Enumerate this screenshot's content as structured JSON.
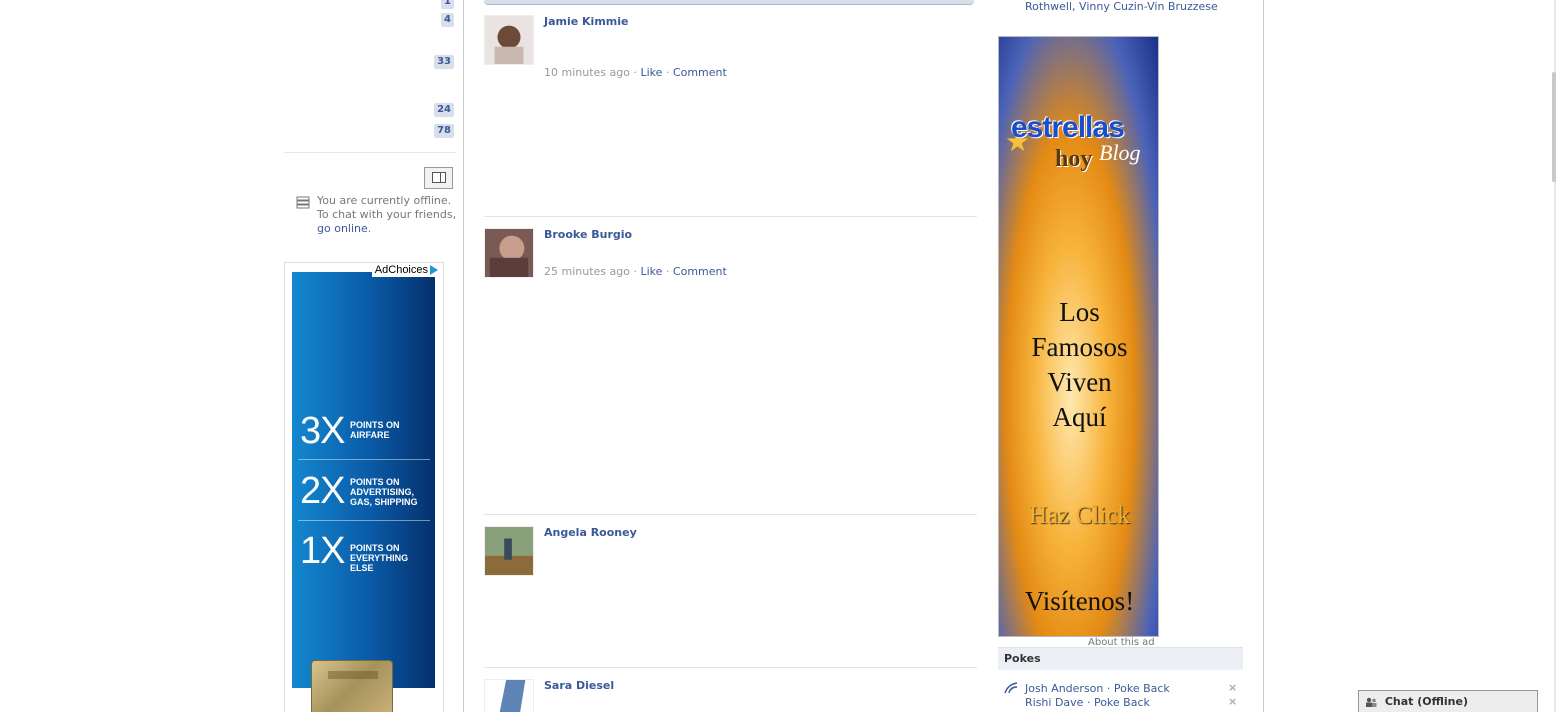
{
  "left": {
    "counts": [
      "1",
      "4",
      "33",
      "24",
      "78"
    ],
    "chat": {
      "status_text": "You are currently offline. To chat with your friends,",
      "go_online": "go online",
      "period": "."
    },
    "ad": {
      "adchoices": "AdChoices",
      "rows": [
        {
          "big": "3X",
          "small_1": "POINTS ON",
          "small_2": "AIRFARE",
          "small_3": ""
        },
        {
          "big": "2X",
          "small_1": "POINTS ON",
          "small_2": "ADVERTISING,",
          "small_3": "GAS, SHIPPING"
        },
        {
          "big": "1X",
          "small_1": "POINTS ON",
          "small_2": "EVERYTHING ELSE",
          "small_3": ""
        }
      ]
    }
  },
  "feed": {
    "stories": [
      {
        "actor": "Jamie Kimmie",
        "time": "10 minutes ago",
        "like": "Like",
        "comment": "Comment"
      },
      {
        "actor": "Brooke Burgio",
        "time": "25 minutes ago",
        "like": "Like",
        "comment": "Comment"
      },
      {
        "actor": "Angela Rooney",
        "time": "",
        "like": "",
        "comment": ""
      },
      {
        "actor": "Sara Diesel",
        "time": "",
        "like": "",
        "comment": ""
      }
    ],
    "separator": "·"
  },
  "right": {
    "friends_tail": "Rothwell, Vinny Cuzin-Vin Bruzzese",
    "ad": {
      "logo_main": "estrellas",
      "logo_hoy": "hoy",
      "logo_blog": "Blog",
      "headline": [
        "Los",
        "Famosos",
        "Viven",
        "Aquí"
      ],
      "cta": "Haz Click",
      "visit": "Visítenos!"
    },
    "about_ad": "About this ad",
    "pokes": {
      "title": "Pokes",
      "items": [
        {
          "name": "Josh Anderson",
          "action": "Poke Back"
        },
        {
          "name": "Rishi Dave",
          "action": "Poke Back"
        }
      ],
      "dismiss": "×"
    }
  },
  "chat_bar": {
    "label": "Chat (Offline)"
  },
  "colors": {
    "link": "#3b5998",
    "badge_bg": "#d8dfea",
    "pokes_header_bg": "#eceff5"
  }
}
